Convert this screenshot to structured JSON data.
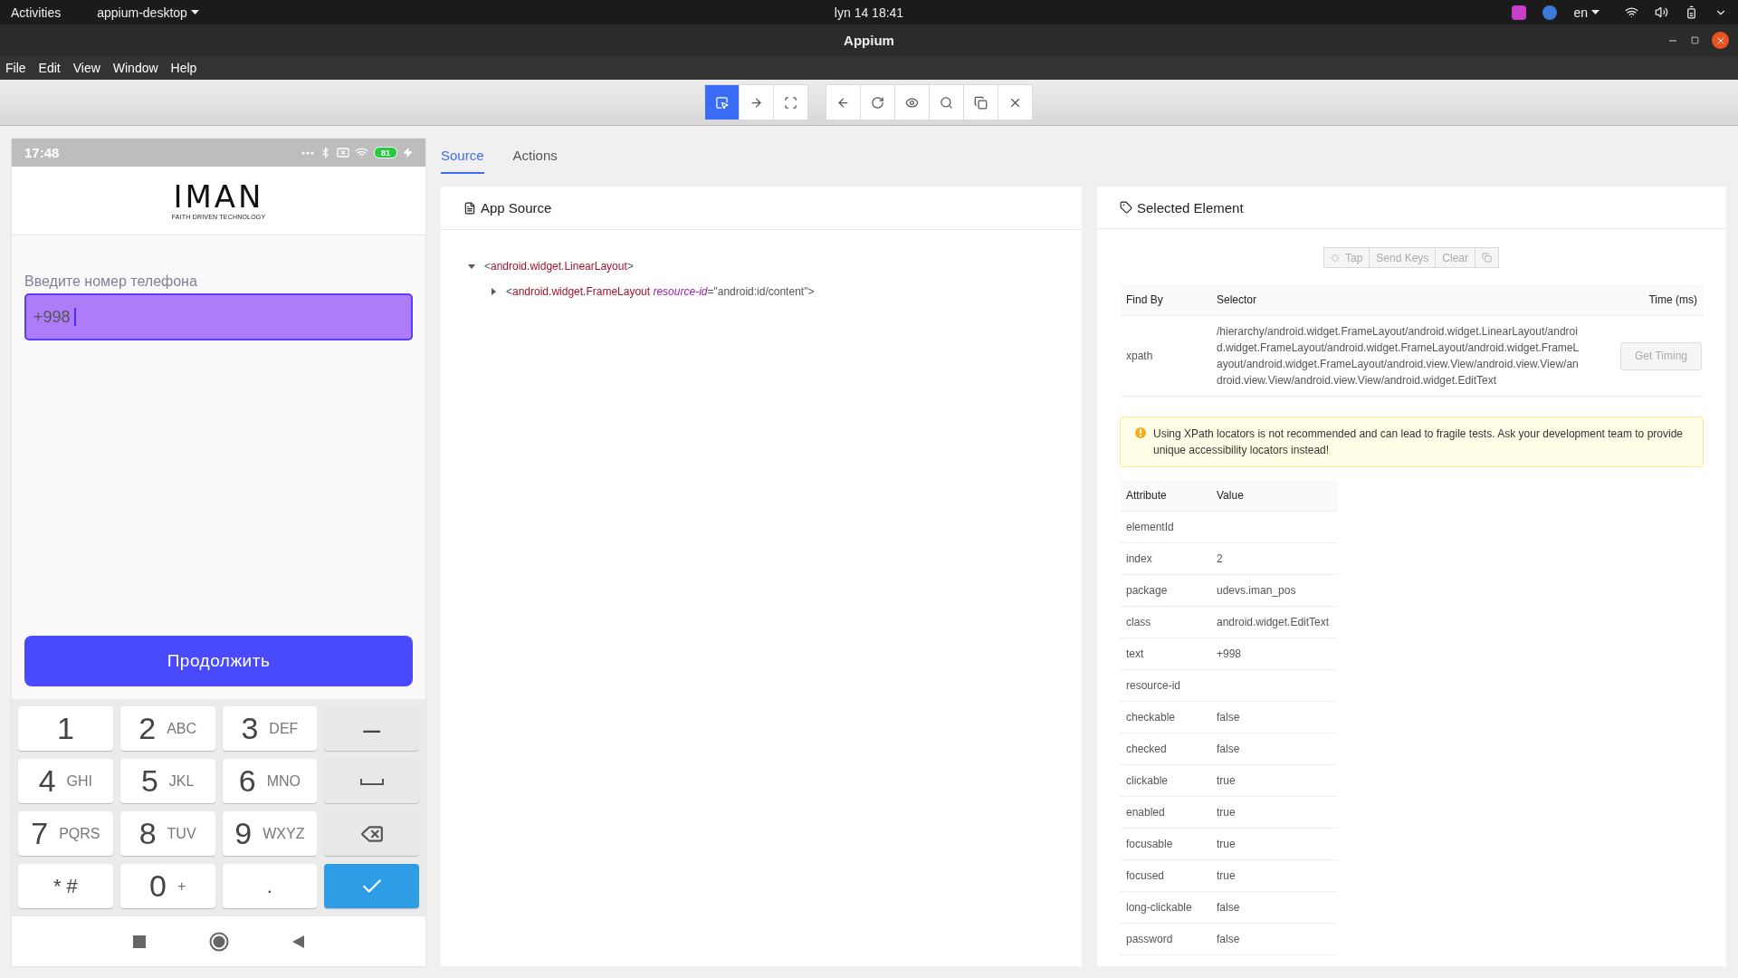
{
  "top_bar": {
    "activities": "Activities",
    "app_menu": "appium-desktop",
    "clock": "lyn 14  18:41",
    "language": "en"
  },
  "window": {
    "title": "Appium"
  },
  "menu": [
    "File",
    "Edit",
    "View",
    "Window",
    "Help"
  ],
  "toolbar": [
    [
      {
        "kind": "select",
        "selected": true
      },
      {
        "kind": "swipe",
        "selected": false
      },
      {
        "kind": "tap-area",
        "selected": false
      }
    ],
    [
      {
        "kind": "back",
        "selected": false
      },
      {
        "kind": "refresh",
        "selected": false
      },
      {
        "kind": "eye",
        "selected": false
      },
      {
        "kind": "search",
        "selected": false
      },
      {
        "kind": "copy",
        "selected": false
      },
      {
        "kind": "close",
        "selected": false
      }
    ]
  ],
  "phone": {
    "time": "17:48",
    "battery": "81",
    "logo": "IMAN",
    "logo_tagline": "FAITH DRIVEN TECHNOLOGY",
    "field_label": "Введите номер телефона",
    "field_value": "+998",
    "field_focused": true,
    "continue_button": "Продолжить",
    "keys": [
      {
        "kind": "char",
        "main": "1"
      },
      {
        "kind": "char",
        "main": "2",
        "sub": "ABC"
      },
      {
        "kind": "char",
        "main": "3",
        "sub": "DEF"
      },
      {
        "kind": "func",
        "main": "–"
      },
      {
        "kind": "char",
        "main": "4",
        "sub": "GHI"
      },
      {
        "kind": "char",
        "main": "5",
        "sub": "JKL"
      },
      {
        "kind": "char",
        "main": "6",
        "sub": "MNO"
      },
      {
        "kind": "space"
      },
      {
        "kind": "char",
        "main": "7",
        "sub": "PQRS"
      },
      {
        "kind": "char",
        "main": "8",
        "sub": "TUV"
      },
      {
        "kind": "char",
        "main": "9",
        "sub": "WXYZ"
      },
      {
        "kind": "backspace"
      },
      {
        "kind": "small",
        "main": "* #"
      },
      {
        "kind": "char",
        "main": "0",
        "sub": "+"
      },
      {
        "kind": "small",
        "main": "."
      },
      {
        "kind": "enter"
      }
    ]
  },
  "tabs": [
    {
      "label": "Source",
      "selected": true
    },
    {
      "label": "Actions",
      "selected": false
    }
  ],
  "app_source": {
    "title": "App Source",
    "tree": [
      {
        "expanded": true,
        "segments": [
          {
            "kind": "punct",
            "text": "<"
          },
          {
            "kind": "tag",
            "text": "android.widget.LinearLayout"
          },
          {
            "kind": "punct",
            "text": ">"
          }
        ],
        "children": [
          {
            "expanded": false,
            "segments": [
              {
                "kind": "punct",
                "text": "<"
              },
              {
                "kind": "tag",
                "text": "android.widget.FrameLayout"
              },
              {
                "kind": "attr",
                "text": " resource-id"
              },
              {
                "kind": "punct",
                "text": "=\"android:id/content\">"
              }
            ]
          }
        ]
      }
    ]
  },
  "selected_element": {
    "title": "Selected Element",
    "actions": [
      {
        "kind": "tap",
        "label": "Tap",
        "disabled": true
      },
      {
        "kind": "text",
        "label": "Send Keys",
        "disabled": true
      },
      {
        "kind": "text",
        "label": "Clear",
        "disabled": true
      },
      {
        "kind": "copy",
        "disabled": true
      }
    ],
    "selector_columns": [
      "Find By",
      "Selector",
      "Time (ms)"
    ],
    "selector_row": {
      "find_by": "xpath",
      "selector": "/hierarchy/android.widget.FrameLayout/android.widget.LinearLayout/android.widget.FrameLayout/android.widget.FrameLayout/android.widget.FrameLayout/android.widget.FrameLayout/android.view.View/android.view.View/android.view.View/android.view.View/android.widget.EditText",
      "button": "Get Timing"
    },
    "warning": "Using XPath locators is not recommended and can lead to fragile tests. Ask your development team to provide unique accessibility locators instead!",
    "attribute_columns": [
      "Attribute",
      "Value"
    ],
    "attributes": [
      {
        "name": "elementId"
      },
      {
        "name": "index",
        "value": "2"
      },
      {
        "name": "package",
        "value": "udevs.iman_pos"
      },
      {
        "name": "class",
        "value": "android.widget.EditText"
      },
      {
        "name": "text",
        "value": "+998"
      },
      {
        "name": "resource-id"
      },
      {
        "name": "checkable",
        "value": "false"
      },
      {
        "name": "checked",
        "value": "false"
      },
      {
        "name": "clickable",
        "value": "true"
      },
      {
        "name": "enabled",
        "value": "true"
      },
      {
        "name": "focusable",
        "value": "true"
      },
      {
        "name": "focused",
        "value": "true"
      },
      {
        "name": "long-clickable",
        "value": "false"
      },
      {
        "name": "password",
        "value": "false"
      }
    ]
  }
}
